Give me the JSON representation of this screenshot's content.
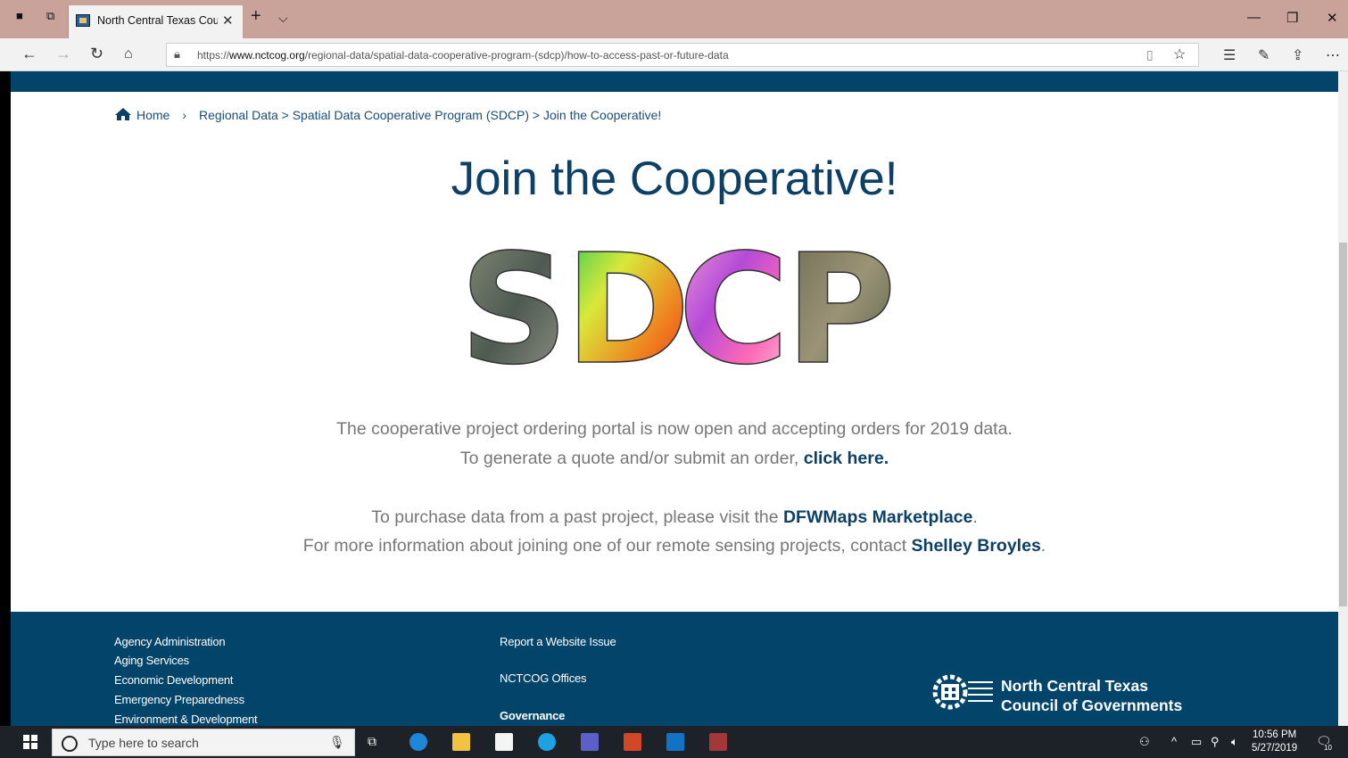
{
  "browser": {
    "tab_title": "North Central Texas Cou",
    "url_prefix": "https://",
    "url_domain": "www.nctcog.org",
    "url_path": "/regional-data/spatial-data-cooperative-program-(sdcp)/how-to-access-past-or-future-data"
  },
  "breadcrumb": {
    "home": "Home",
    "separator": "›",
    "trail": "Regional Data > Spatial Data Cooperative Program (SDCP) > Join the Cooperative!"
  },
  "page": {
    "title": "Join the Cooperative!",
    "logo_text": "SDCP",
    "line1": "The cooperative project ordering portal is now open and accepting orders for 2019 data.",
    "line2_prefix": "To generate a quote and/or submit an order, ",
    "line2_link": "click here.",
    "line3_prefix": "To purchase data from a past project, please visit the ",
    "line3_link": "DFWMaps Marketplace",
    "line3_suffix": ".",
    "line4_prefix": "For more information about joining one of our remote sensing projects, contact ",
    "line4_link": "Shelley Broyles",
    "line4_suffix": "."
  },
  "footer": {
    "col1": [
      "Agency Administration",
      "Aging Services",
      "Economic Development",
      "Emergency Preparedness",
      "Environment & Development"
    ],
    "col2": [
      "Report a Website Issue",
      "NCTCOG Offices",
      "Governance"
    ],
    "org_line1": "North Central Texas",
    "org_line2": "Council of Governments"
  },
  "taskbar": {
    "search_placeholder": "Type here to search",
    "time": "10:56 PM",
    "date": "5/27/2019",
    "notification_count": "10"
  },
  "colors": {
    "brand_navy": "#03446b",
    "title_blue": "#0d4066",
    "body_gray": "#777777",
    "tab_bar": "#c9a29a"
  }
}
